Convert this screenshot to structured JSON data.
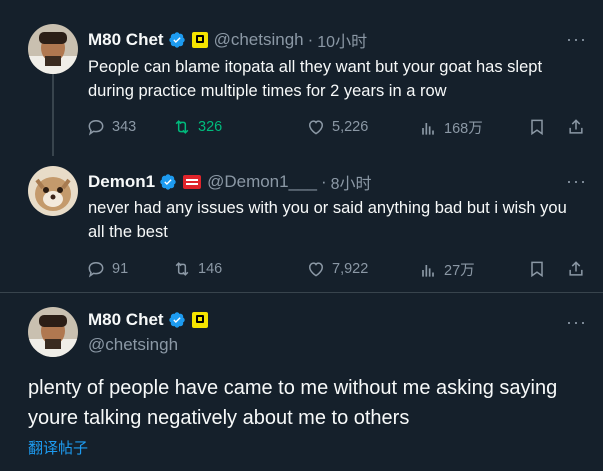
{
  "tweets": [
    {
      "name": "M80 Chet",
      "handle": "@chetsingh",
      "time": "10小时",
      "text": "People can blame itopata all they want but your goat has slept during practice multiple times for 2 years in a row",
      "replies": "343",
      "retweets": "326",
      "likes": "5,226",
      "views": "168万"
    },
    {
      "name": "Demon1",
      "handle": "@Demon1___",
      "time": "8小时",
      "text": "never had any issues with you or said anything bad but i wish you all the best",
      "replies": "91",
      "retweets": "146",
      "likes": "7,922",
      "views": "27万"
    }
  ],
  "focused": {
    "name": "M80 Chet",
    "handle": "@chetsingh",
    "text": "plenty of people have came to me without me asking saying youre talking negatively about me to others",
    "translate": "翻译帖子"
  },
  "colors": {
    "background": "#15202b",
    "accent": "#1d9bf0",
    "muted": "#8b98a5",
    "retweet_active": "#00ba7c",
    "badge_m80": "#f5e400",
    "badge_demon": "#e0242b"
  },
  "icons": [
    "verified-icon",
    "reply-icon",
    "retweet-icon",
    "like-icon",
    "views-icon",
    "bookmark-icon",
    "share-icon",
    "more-icon"
  ]
}
